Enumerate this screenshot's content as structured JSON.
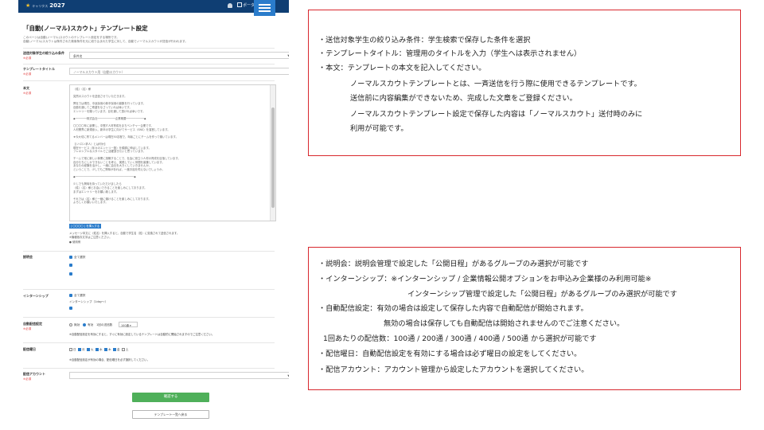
{
  "app": {
    "header": {
      "logo_text": "2027",
      "logo_sub": "キャリタス",
      "portal_label": "ポータル"
    },
    "title": "「自動(ノーマル)スカウト」テンプレート設定",
    "description": [
      "このページは自動(ノーマル)スカウトのテンプレート設定をする場所です。",
      "自動(ノーマル)スカウトは条件された検索条件を元に絞り込まれた学生に対して、自動でノーマルスカウトが送信が行われます。"
    ],
    "fields": {
      "filter": {
        "label": "送信対象学生の絞り込み条件",
        "required": "※必須",
        "value": "条件名"
      },
      "template_title": {
        "label": "テンプレートタイトル",
        "required": "※必須",
        "value": "ノーマルスカウト用（自動スカウト）"
      },
      "body": {
        "label": "本文",
        "required": "※必須",
        "lines": [
          "〈姓〉〈名〉様",
          "",
          "突然のスカウトを送信させていただきます。",
          "",
          "弊社では現在、中途採用の新卒採用の募集を行っています。",
          "自動を通してご希望をなさっていれば幸いです。",
          "エントリーを賜っています。目を通して頂ければ幸いです。",
          "",
          "◆───────株式会社───────────企業概要───────────◆",
          "",
          "〇〇〇〇年に創業し、中堅IT人材育成をまちベンチャー企業です。",
          "人材業界に新規参入、新卒の学生に向けてサービス〈SNS〉を運営しています。",
          "",
          "★今大切に育てるメンバーは現在50名程で、年齢ごとにチームを作って働いています。",
          "",
          "【〈ハロン求人〉とは何か】",
          "現在サービス〈年々のエントリー数〉を順調に伸ばしています。",
          "フレキシブルなスタイルでご活躍頂きたいと思っています。",
          "",
          "チームで常に新しい事業に挑戦することで、社会に役立つ人材の育成を目指しています。",
          "自分たちにしかできないことを考え、実践していく仲間を募集しています。",
          "あなたの経験を活かし、一緒に会社を大きくしていきませんか。",
          "ということで、少しでもご興味があれば、一度お話を伺えないでしょうか。",
          "",
          "◆────────────────────────────────────◆",
          "",
          "少しでも興味を持っていただけましたら",
          "〈姓〉〈名〉様とお会いできることを楽しみにしております。",
          "まずはエントリーをお願い致します。",
          "",
          "それでは〈名〉様と一緒に働けることを楽しみにしております。",
          "よろしくお願いいたします。"
        ],
        "insert_button": "[ 〇〇〇〇 ] を挿入する",
        "notes": [
          "メッセージ本文に〈姓名〉を挿入すると、自動で学生名（姓）に変換されて送信されます。",
          "※機種依存文字はご注意ください。",
          "● 使用例"
        ]
      },
      "briefing": {
        "label": "説明会",
        "options": [
          "全て選択",
          "",
          "",
          ""
        ]
      },
      "internship": {
        "label": "インターンシップ",
        "options": [
          "全て選択",
          "インターンシップ（1day～）",
          ""
        ]
      },
      "auto_delivery": {
        "label": "自動配信設定",
        "required": "※必須",
        "radio_off": "無効",
        "radio_on": "有効",
        "count_label": "1回の送信数",
        "count_value": "100通",
        "note": "※自動配信設定を有効にすると、すぐに有効に設定しているテンプレートは自動的に開始されますのでご注意ください。"
      },
      "delivery_days": {
        "label": "配信曜日",
        "days": [
          "日",
          "月",
          "火",
          "水",
          "木",
          "金",
          "土"
        ],
        "note": "※自動配信設定が有効の場合、配信曜日を必ず選択してください。"
      },
      "account": {
        "label": "配信アカウント",
        "required": "※必須",
        "value": ""
      }
    },
    "confirm_button": "確認する",
    "back_button": "テンプレート一覧へ戻る"
  },
  "annotations": {
    "top": [
      "・送信対象学生の絞り込み条件：学生検索で保存した条件を選択",
      "・テンプレートタイトル：管理用のタイトルを入力（学生へは表示されません）",
      "・本文：テンプレートの本文を記入してください。",
      "ノーマルスカウトテンプレートとは、一斉送信を行う際に使用できるテンプレートです。",
      "送信前に内容編集ができないため、完成した文章をご登録ください。",
      "ノーマルスカウトテンプレート設定で保存した内容は「ノーマルスカウト」送付時のみに",
      "利用が可能です。"
    ],
    "bottom": [
      "・説明会：説明会管理で設定した「公開日程」があるグループのみ選択が可能です",
      "・インターンシップ：※インターンシップ / 企業情報公開オプションをお申込み企業様のみ利用可能※",
      "インターンシップ管理で設定した「公開日程」があるグループのみ選択が可能です",
      "・自動配信設定：有効の場合は設定して保存した内容で自動配信が開始されます。",
      "無効の場合は保存しても自動配信は開始されませんのでご注意ください。",
      "1回あたりの配信数：100通 / 200通 / 300通 / 400通 / 500通 から選択が可能です",
      "・配信曜日：自動配信設定を有効にする場合は必ず曜日の設定をしてください。",
      "・配信アカウント：アカウント管理から設定したアカウントを選択してください。"
    ]
  },
  "colors": {
    "header_bg": "#0f3e73",
    "menu_button": "#2a7ccb",
    "confirm_button": "#4fb05a",
    "annotation_border": "#d8282e",
    "required_text": "#e34848"
  }
}
